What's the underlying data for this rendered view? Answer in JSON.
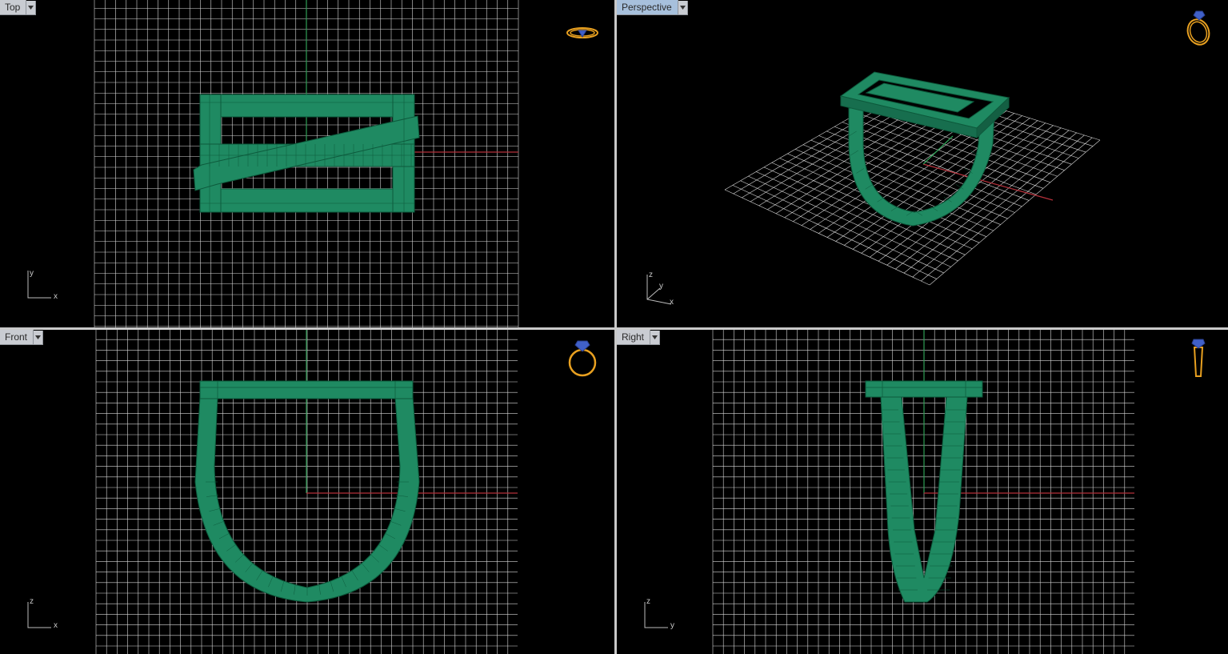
{
  "viewports": {
    "top": {
      "label": "Top",
      "axis_h": "x",
      "axis_v": "y"
    },
    "persp": {
      "label": "Perspective",
      "axis_h": "x",
      "axis_v": "y",
      "axis_z": "z"
    },
    "front": {
      "label": "Front",
      "axis_h": "x",
      "axis_v": "z"
    },
    "right": {
      "label": "Right",
      "axis_h": "y",
      "axis_v": "z"
    }
  },
  "colors": {
    "background": "#000000",
    "grid": "#d8d8d8",
    "model_fill": "#1f8a62",
    "model_edge": "#0d5a3c",
    "axis_x": "#b3303a",
    "axis_y": "#2e9e55",
    "tab_bg": "#c9ccd2",
    "tab_active_bg": "#a7c0dc",
    "icon_gold": "#e8a020",
    "icon_blue": "#4060c8"
  },
  "icons": {
    "view_menu": "chevron-down-icon",
    "nav_top": "ring-top-view-icon",
    "nav_persp": "ring-perspective-icon",
    "nav_front": "ring-front-view-icon",
    "nav_right": "ring-side-view-icon"
  }
}
